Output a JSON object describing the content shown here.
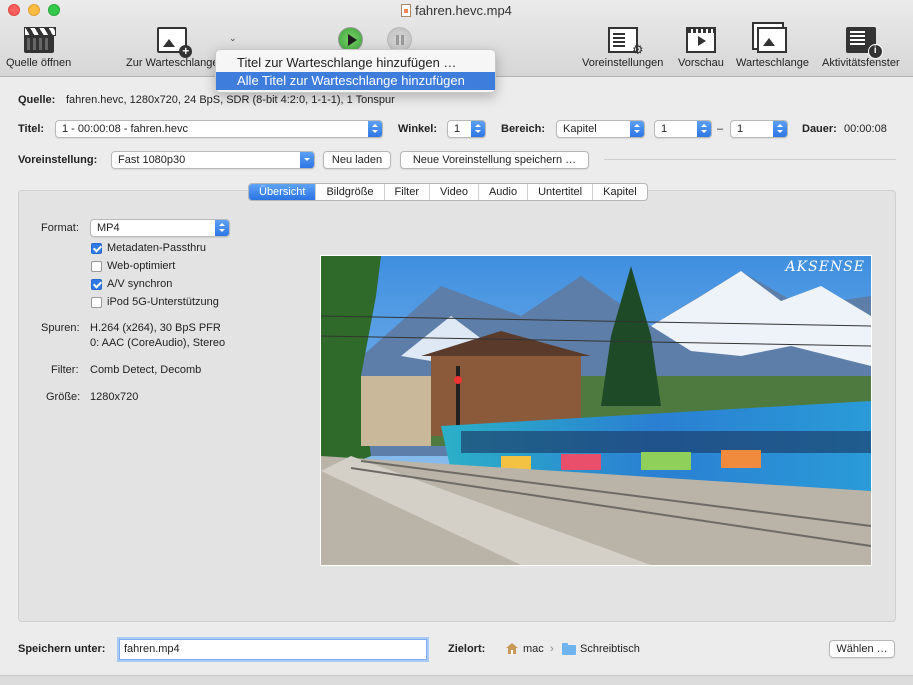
{
  "window": {
    "title": "fahren.hevc.mp4"
  },
  "toolbar": {
    "open_source": "Quelle öffnen",
    "add_queue": "Zur Warteschlange",
    "presets": "Voreinstellungen",
    "preview": "Vorschau",
    "queue": "Warteschlange",
    "activity": "Aktivitätsfenster"
  },
  "menu": {
    "items": [
      "Titel zur Warteschlange hinzufügen …",
      "Alle Titel zur Warteschlange hinzufügen"
    ]
  },
  "source": {
    "label": "Quelle:",
    "value": "fahren.hevc, 1280x720, 24 BpS, SDR (8-bit 4:2:0, 1-1-1), 1 Tonspur"
  },
  "title_row": {
    "title_label": "Titel:",
    "title_value": "1 - 00:00:08 - fahren.hevc",
    "angle_label": "Winkel:",
    "angle_value": "1",
    "range_label": "Bereich:",
    "range_type": "Kapitel",
    "range_start": "1",
    "range_sep": "–",
    "range_end": "1",
    "duration_label": "Dauer:",
    "duration_value": "00:00:08"
  },
  "preset_row": {
    "label": "Voreinstellung:",
    "value": "Fast 1080p30",
    "reload": "Neu laden",
    "save_new": "Neue Voreinstellung speichern …"
  },
  "tabs": [
    "Übersicht",
    "Bildgröße",
    "Filter",
    "Video",
    "Audio",
    "Untertitel",
    "Kapitel"
  ],
  "summary": {
    "format_label": "Format:",
    "format_value": "MP4",
    "options": [
      {
        "label": "Metadaten-Passthru",
        "checked": true
      },
      {
        "label": "Web-optimiert",
        "checked": false
      },
      {
        "label": "A/V synchron",
        "checked": true
      },
      {
        "label": "iPod 5G-Unterstützung",
        "checked": false
      }
    ],
    "tracks_label": "Spuren:",
    "tracks_line1": "H.264 (x264), 30 BpS PFR",
    "tracks_line2": "0: AAC (CoreAudio), Stereo",
    "filters_label": "Filter:",
    "filters_value": "Comb Detect, Decomb",
    "size_label": "Größe:",
    "size_value": "1280x720",
    "preview_watermark": "AKSENSE"
  },
  "save": {
    "label": "Speichern unter:",
    "filename": "fahren.mp4",
    "dest_label": "Zielort:",
    "dest_home": "mac",
    "dest_folder": "Schreibtisch",
    "choose": "Wählen …"
  },
  "colors": {
    "accent": "#2a74e3",
    "menu_highlight": "#3f7ddc"
  }
}
